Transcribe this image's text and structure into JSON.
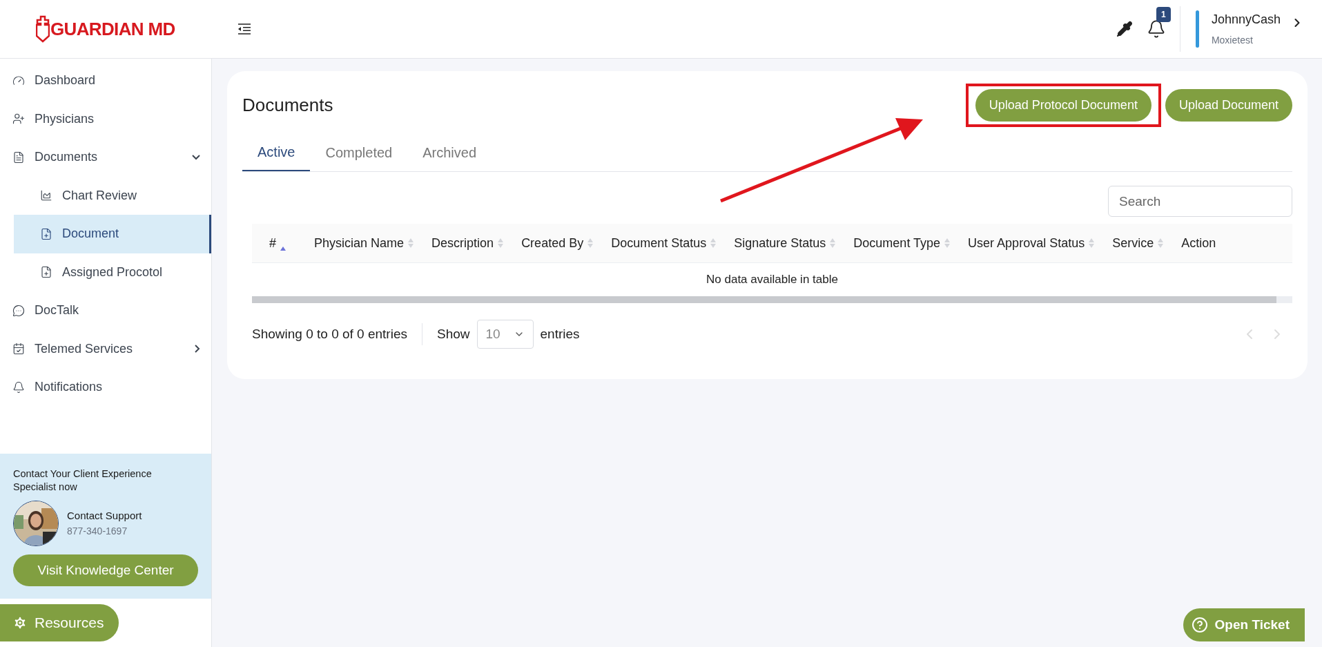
{
  "brand": {
    "name": "GUARDIAN MD"
  },
  "header": {
    "notification_count": "1",
    "user": {
      "name": "JohnnyCash",
      "org": "Moxietest"
    }
  },
  "sidebar": {
    "items": [
      {
        "label": "Dashboard",
        "selected": false
      },
      {
        "label": "Physicians",
        "selected": false
      },
      {
        "label": "Documents",
        "selected": false,
        "expanded": true,
        "children": [
          {
            "label": "Chart Review",
            "selected": false
          },
          {
            "label": "Document",
            "selected": true
          },
          {
            "label": "Assigned Procotol",
            "selected": false
          }
        ]
      },
      {
        "label": "DocTalk",
        "selected": false
      },
      {
        "label": "Telemed Services",
        "selected": false,
        "expanded": false
      },
      {
        "label": "Notifications",
        "selected": false
      }
    ],
    "contact": {
      "text": "Contact Your Client Experience Specialist now",
      "name": "Contact Support",
      "phone": "877-340-1697",
      "button": "Visit Knowledge Center"
    },
    "resources_button": "Resources"
  },
  "card": {
    "title": "Documents",
    "buttons": [
      {
        "label": "Upload Protocol Document",
        "highlighted": true
      },
      {
        "label": "Upload Document",
        "highlighted": false
      }
    ],
    "tabs": [
      {
        "label": "Active",
        "selected": true
      },
      {
        "label": "Completed",
        "selected": false
      },
      {
        "label": "Archived",
        "selected": false
      }
    ],
    "search": {
      "placeholder": "Search"
    },
    "table": {
      "columns": [
        {
          "label": "#",
          "sortable": true,
          "selected": true
        },
        {
          "label": "Physician Name",
          "sortable": true,
          "selected": false
        },
        {
          "label": "Description",
          "sortable": true,
          "selected": false
        },
        {
          "label": "Created By",
          "sortable": true,
          "selected": false
        },
        {
          "label": "Document Status",
          "sortable": true,
          "selected": false
        },
        {
          "label": "Signature Status",
          "sortable": true,
          "selected": false
        },
        {
          "label": "Document Type",
          "sortable": true,
          "selected": false
        },
        {
          "label": "User Approval Status",
          "sortable": true,
          "selected": false
        },
        {
          "label": "Service",
          "sortable": true,
          "selected": false
        },
        {
          "label": "Action",
          "sortable": false,
          "selected": false
        }
      ],
      "empty_text": "No data available in table"
    },
    "footer": {
      "info": "Showing 0 to 0 of 0 entries",
      "show_label": "Show",
      "page_size": "10",
      "entries_label": "entries"
    }
  },
  "open_ticket_button": "Open Ticket"
}
